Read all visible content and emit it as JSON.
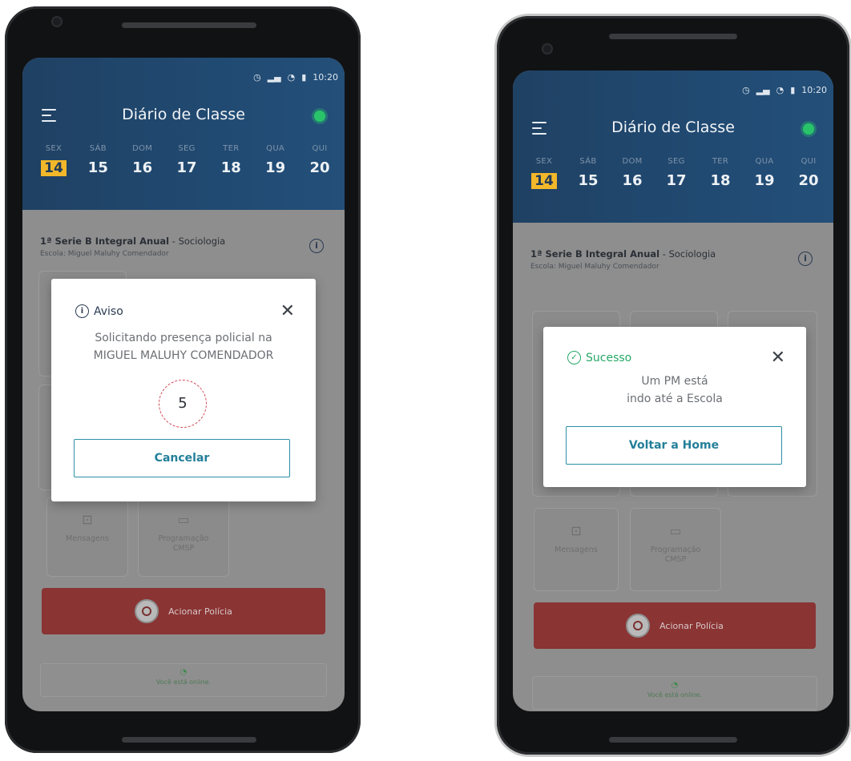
{
  "phone_left": {
    "status": {
      "time": "10:20",
      "icons": [
        "alarm-icon",
        "signal-icon",
        "wifi-icon",
        "battery-icon"
      ]
    },
    "app_title": "Diário de Classe",
    "days": [
      {
        "name": "SEX",
        "date": "14",
        "active": true
      },
      {
        "name": "SÁB",
        "date": "15"
      },
      {
        "name": "DOM",
        "date": "16"
      },
      {
        "name": "SEG",
        "date": "17"
      },
      {
        "name": "TER",
        "date": "18"
      },
      {
        "name": "QUA",
        "date": "19"
      },
      {
        "name": "QUI",
        "date": "20"
      }
    ],
    "course": {
      "class": "1ª Serie B Integral Anual",
      "subject": " - Sociologia",
      "school": "Escola: Miguel Maluhy Comendador"
    },
    "tiles": [
      {
        "label": "Mensagens",
        "icon": "message-icon"
      },
      {
        "label": "Programação CMSP",
        "icon": "tv-icon"
      }
    ],
    "police_button": "Acionar Polícia",
    "online_text": "Você está online.",
    "dialog": {
      "title": "Aviso",
      "message_line1": "Solicitando presença policial na",
      "message_line2": "MIGUEL MALUHY COMENDADOR",
      "countdown": "5",
      "button": "Cancelar"
    }
  },
  "phone_right": {
    "status": {
      "time": "10:20"
    },
    "app_title": "Diário de Classe",
    "days": [
      {
        "name": "SEX",
        "date": "14",
        "active": true
      },
      {
        "name": "SÁB",
        "date": "15"
      },
      {
        "name": "DOM",
        "date": "16"
      },
      {
        "name": "SEG",
        "date": "17"
      },
      {
        "name": "TER",
        "date": "18"
      },
      {
        "name": "QUA",
        "date": "19"
      },
      {
        "name": "QUI",
        "date": "20"
      }
    ],
    "course": {
      "class": "1ª Serie B Integral Anual",
      "subject": " - Sociologia",
      "school": "Escola: Miguel Maluhy Comendador"
    },
    "tiles": [
      {
        "label": "Mensagens",
        "icon": "message-icon"
      },
      {
        "label": "Programação CMSP",
        "icon": "tv-icon"
      }
    ],
    "police_button": "Acionar Polícia",
    "online_text": "Você está online.",
    "dialog": {
      "title": "Sucesso",
      "message_line1": "Um PM está",
      "message_line2": "indo até a Escola",
      "button": "Voltar a Home"
    }
  },
  "colors": {
    "header": "#214a72",
    "accent_date": "#f3b72a",
    "online": "#29c46a",
    "success": "#25a867",
    "button_border": "#2c8fa7",
    "police": "#8a3434"
  }
}
